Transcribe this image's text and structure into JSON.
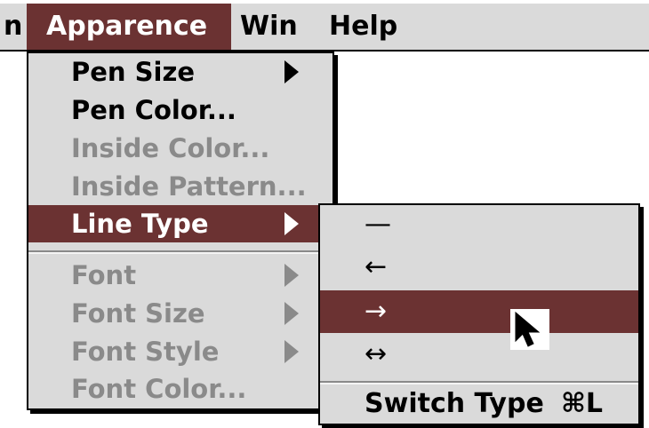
{
  "menubar": {
    "items": [
      {
        "label": "n"
      },
      {
        "label": "Apparence"
      },
      {
        "label": "Win"
      },
      {
        "label": "Help"
      }
    ]
  },
  "apparence_menu": {
    "items": [
      {
        "label": "Pen Size",
        "enabled": true,
        "submenu": true
      },
      {
        "label": "Pen Color...",
        "enabled": true,
        "submenu": false
      },
      {
        "label": "Inside Color...",
        "enabled": false,
        "submenu": false
      },
      {
        "label": "Inside Pattern...",
        "enabled": false,
        "submenu": false
      },
      {
        "label": "Line Type",
        "enabled": true,
        "submenu": true,
        "highlighted": true
      },
      {
        "label": "Font",
        "enabled": false,
        "submenu": true
      },
      {
        "label": "Font Size",
        "enabled": false,
        "submenu": true
      },
      {
        "label": "Font Style",
        "enabled": false,
        "submenu": true
      },
      {
        "label": "Font Color...",
        "enabled": false,
        "submenu": false
      }
    ]
  },
  "line_type_submenu": {
    "items": [
      {
        "glyph": "—",
        "meaning": "plain line"
      },
      {
        "glyph": "←",
        "meaning": "arrow at start"
      },
      {
        "glyph": "→",
        "meaning": "arrow at end",
        "highlighted": true
      },
      {
        "glyph": "↔",
        "meaning": "arrows at both ends"
      }
    ],
    "switch_type": {
      "label": "Switch Type",
      "shortcut": "⌘L"
    }
  },
  "colors": {
    "highlight": "#6b3232",
    "menu_bg": "#dadada",
    "disabled_text": "#8a8a8a"
  },
  "icons": [
    "submenu-arrow-icon",
    "mouse-pointer-icon"
  ]
}
